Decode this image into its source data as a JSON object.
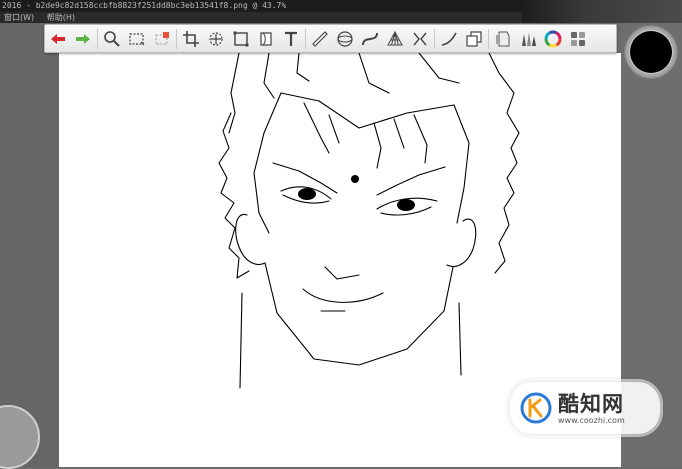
{
  "window": {
    "title": "2016 - b2de9c82d158ccbfb8823f251dd8bc3eb13541f8.png @ 43.7%"
  },
  "menu": [
    {
      "label": "窗口(W)"
    },
    {
      "label": "帮助(H)"
    }
  ],
  "toolbar": {
    "tools": [
      {
        "name": "undo-icon",
        "color": "#d8262a"
      },
      {
        "name": "redo-icon",
        "color": "#5db54a"
      },
      {
        "name": "zoom-icon"
      },
      {
        "name": "select-rect-icon"
      },
      {
        "name": "deselect-icon",
        "color": "#e5533d"
      },
      {
        "name": "crop-icon"
      },
      {
        "name": "move-icon"
      },
      {
        "name": "transform-icon"
      },
      {
        "name": "warp-icon"
      },
      {
        "name": "text-icon"
      },
      {
        "name": "ruler-icon"
      },
      {
        "name": "ellipse-ruler-icon"
      },
      {
        "name": "curve-ruler-icon"
      },
      {
        "name": "perspective-grid-icon"
      },
      {
        "name": "symmetry-icon"
      },
      {
        "name": "stroke-icon"
      },
      {
        "name": "layer-copy-icon"
      },
      {
        "name": "pages-icon"
      },
      {
        "name": "brush-library-icon"
      },
      {
        "name": "color-wheel-icon"
      },
      {
        "name": "swatches-icon"
      }
    ]
  },
  "color_well": {
    "color": "#000000"
  },
  "watermark": {
    "name": "酷知网",
    "url": "www.coozhi.com"
  }
}
